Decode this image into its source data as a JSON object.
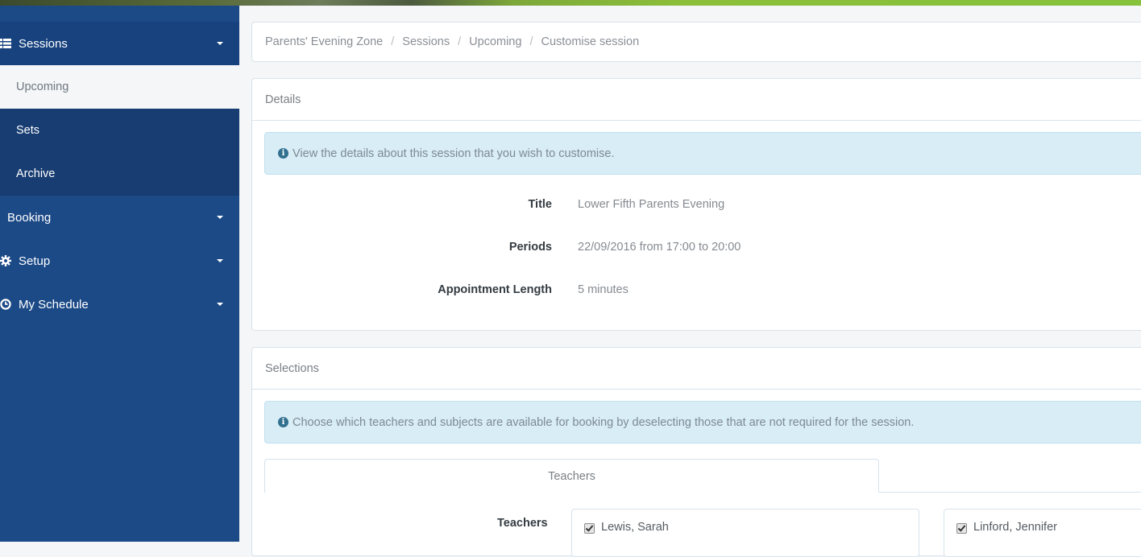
{
  "sidebar": {
    "items": [
      {
        "label": "Sessions",
        "icon": "list-icon",
        "expanded": true,
        "children": [
          {
            "label": "Upcoming",
            "active": true
          },
          {
            "label": "Sets",
            "active": false
          },
          {
            "label": "Archive",
            "active": false
          }
        ]
      },
      {
        "label": "Booking",
        "icon": null
      },
      {
        "label": "Setup",
        "icon": "gear-icon"
      },
      {
        "label": "My Schedule",
        "icon": "clock-icon"
      }
    ]
  },
  "breadcrumb": [
    "Parents' Evening Zone",
    "Sessions",
    "Upcoming",
    "Customise session"
  ],
  "details": {
    "heading": "Details",
    "info": "View the details about this session that you wish to customise.",
    "fields": [
      {
        "label": "Title",
        "value": "Lower Fifth Parents Evening"
      },
      {
        "label": "Periods",
        "value": "22/09/2016 from 17:00 to 20:00"
      },
      {
        "label": "Appointment Length",
        "value": "5 minutes"
      }
    ]
  },
  "selections": {
    "heading": "Selections",
    "info": "Choose which teachers and subjects are available for booking by deselecting those that are not required for the session.",
    "tabs": [
      {
        "label": "Teachers",
        "active": true
      }
    ],
    "teachers_label": "Teachers",
    "teachers": [
      {
        "name": "Lewis, Sarah",
        "checked": true
      },
      {
        "name": "Linford, Jennifer",
        "checked": true
      }
    ]
  },
  "colors": {
    "sidebar_bg": "#1c4a87",
    "sidebar_active_bg": "#17427d",
    "info_bg": "#d9edf7",
    "info_icon": "#31708f"
  }
}
